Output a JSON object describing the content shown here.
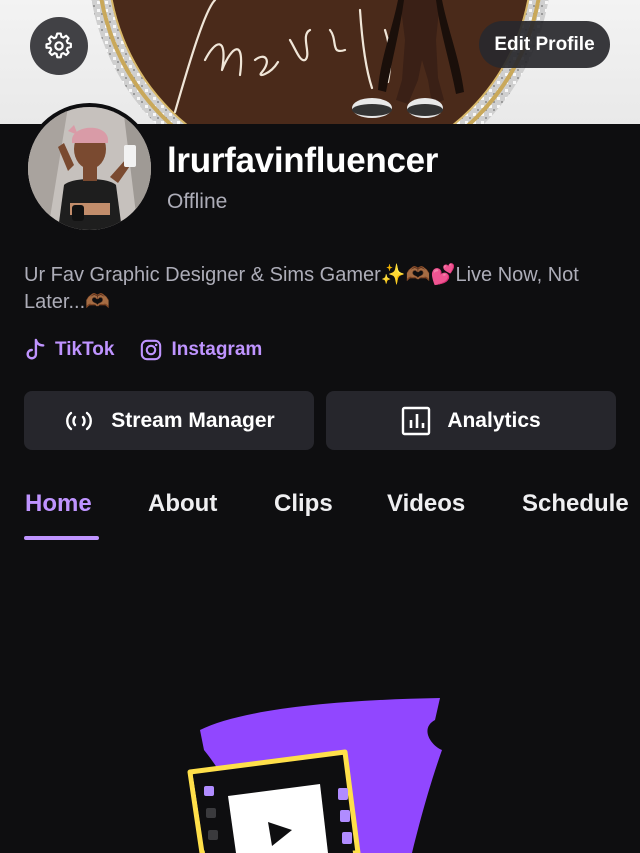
{
  "banner": {
    "script_text": "Made It"
  },
  "header": {
    "settings_icon": "gear-icon",
    "edit_profile_label": "Edit Profile"
  },
  "profile": {
    "username": "lrurfavinfluencer",
    "status": "Offline",
    "bio": "Ur Fav Graphic Designer & Sims Gamer✨🫶🏾💕Live Now, Not Later...🫶🏾"
  },
  "socials": [
    {
      "label": "TikTok",
      "icon": "tiktok-icon"
    },
    {
      "label": "Instagram",
      "icon": "instagram-icon"
    }
  ],
  "actions": {
    "stream_manager_label": "Stream Manager",
    "stream_manager_icon": "broadcast-icon",
    "analytics_label": "Analytics",
    "analytics_icon": "bar-chart-icon"
  },
  "tabs": [
    {
      "label": "Home",
      "active": true
    },
    {
      "label": "About",
      "active": false
    },
    {
      "label": "Clips",
      "active": false
    },
    {
      "label": "Videos",
      "active": false
    },
    {
      "label": "Schedule",
      "active": false
    }
  ],
  "colors": {
    "background": "#0e0e10",
    "accent": "#bf94ff",
    "button_bg": "#26262c",
    "muted_text": "#adadb8",
    "illustration_purple": "#9147ff",
    "illustration_yellow": "#ffe04a"
  }
}
